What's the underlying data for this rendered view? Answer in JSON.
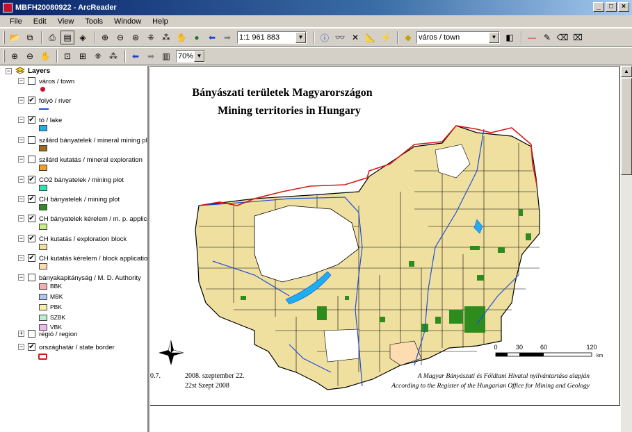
{
  "window": {
    "title": "MBFH20080922 - ArcReader"
  },
  "menu": [
    "File",
    "Edit",
    "View",
    "Tools",
    "Window",
    "Help"
  ],
  "toolbar": {
    "scale": "1:1 961 883",
    "layer_combo": "város / town",
    "zoom_combo": "70%"
  },
  "toc": {
    "root": "Layers",
    "layers": [
      {
        "name": "város / town",
        "checked": false,
        "symbol": "point",
        "color": "#c8102e"
      },
      {
        "name": "folyó / river",
        "checked": true,
        "symbol": "line",
        "color": "#1e4fd8"
      },
      {
        "name": "tó / lake",
        "checked": true,
        "symbol": "fill",
        "color": "#1eaef0"
      },
      {
        "name": "szilárd bányatelek / mineral mining plot",
        "checked": false,
        "symbol": "fill",
        "color": "#9c6b1c"
      },
      {
        "name": "szilárd kutatás / mineral exploration",
        "checked": false,
        "symbol": "fill",
        "color": "#f0a020"
      },
      {
        "name": "CO2 bányatelek / mining plot",
        "checked": true,
        "symbol": "fill",
        "color": "#30e0b0"
      },
      {
        "name": "CH bányatelek / mining plot",
        "checked": true,
        "symbol": "fill",
        "color": "#2e8b1e"
      },
      {
        "name": "CH bányatelek kérelem / m. p. application",
        "checked": true,
        "symbol": "fill",
        "color": "#c8f080"
      },
      {
        "name": "CH kutatás / exploration block",
        "checked": true,
        "symbol": "fill",
        "color": "#f0e0a0"
      },
      {
        "name": "CH kutatás kérelem / block application",
        "checked": true,
        "symbol": "fill",
        "color": "#fcdcb0"
      },
      {
        "name": "bányakapitányság / M. D. Authority",
        "checked": false,
        "symbol": "group",
        "color": ""
      },
      {
        "name": "régió / region",
        "checked": false,
        "symbol": "none",
        "color": ""
      },
      {
        "name": "országhatár / state border",
        "checked": true,
        "symbol": "outline",
        "color": "#d81818"
      }
    ],
    "authorities": [
      {
        "name": "BBK",
        "color": "#f4b0b0"
      },
      {
        "name": "MBK",
        "color": "#b0c4f0"
      },
      {
        "name": "PBK",
        "color": "#f8f0a8"
      },
      {
        "name": "SZBK",
        "color": "#b8f0d0"
      },
      {
        "name": "VBK",
        "color": "#f0b8f0"
      }
    ]
  },
  "map": {
    "title_hu": "Bányászati területek Magyarországon",
    "title_en": "Mining territories in Hungary",
    "date_hu": "2008. szeptember 22.",
    "date_en": "22st Szept 2008",
    "credit_hu": "A Magyar Bányászati és Földtani Hivatal nyilvántartása alapján",
    "credit_en": "According to the Register of the Hungarian Office for Mining and Geology",
    "version": "0.7.",
    "scale_ticks": [
      "0",
      "30",
      "60",
      "120"
    ],
    "scale_unit": "km",
    "colors": {
      "border": "#d81818",
      "exploration": "#f0e0a0",
      "mining": "#2e8b1e",
      "water": "#1e4fd8"
    }
  }
}
